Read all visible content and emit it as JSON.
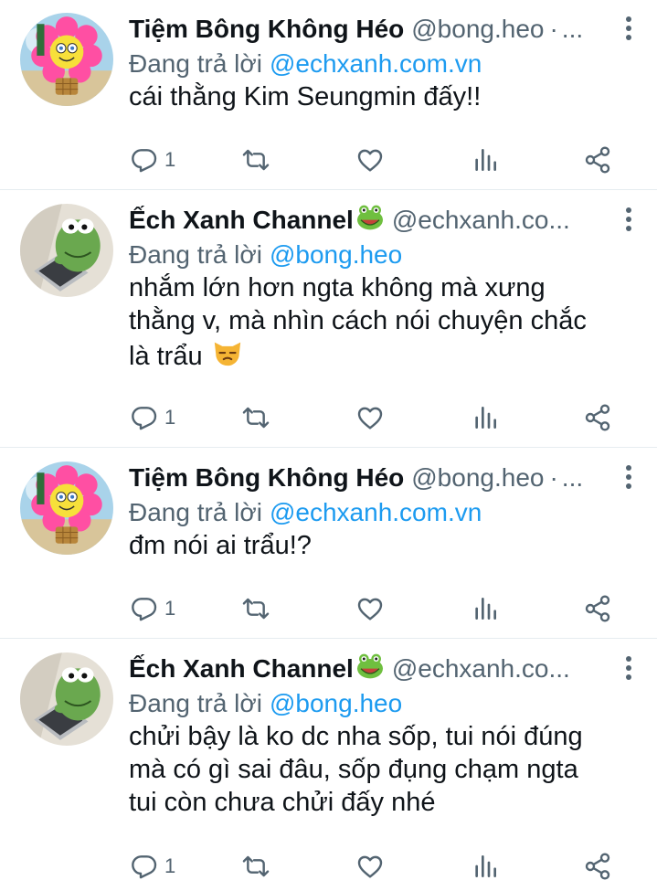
{
  "colors": {
    "link": "#1d9bf0",
    "muted": "#536471",
    "text": "#0f1419"
  },
  "reply_prefix": "Đang trả lời",
  "tweets": [
    {
      "name": "Tiệm Bông Không Héo",
      "handle": "@bong.heo",
      "separator": "·",
      "ellipsis": "...",
      "replying_to": "@echxanh.com.vn",
      "text": "cái thằng Kim Seungmin đấy!!",
      "reply_count": "1",
      "avatar": "sponge-flower-avatar"
    },
    {
      "name": "Ếch Xanh Channel",
      "handle": "@echxanh.co...",
      "name_emoji": "frog-emoji",
      "replying_to": "@bong.heo",
      "text": "nhắm lớn hơn ngta không mà xưng thằng v, mà nhìn cách nói chuyện chắc là trẩu",
      "text_emoji": "unamused-cat-emoji",
      "reply_count": "1",
      "avatar": "kermit-laptop-avatar"
    },
    {
      "name": "Tiệm Bông Không Héo",
      "handle": "@bong.heo",
      "separator": "·",
      "ellipsis": "...",
      "replying_to": "@echxanh.com.vn",
      "text": "đm nói ai trẩu!?",
      "reply_count": "1",
      "avatar": "sponge-flower-avatar"
    },
    {
      "name": "Ếch Xanh Channel",
      "handle": "@echxanh.co...",
      "name_emoji": "frog-emoji",
      "replying_to": "@bong.heo",
      "text": "chửi bậy là ko dc nha sốp, tui nói đúng mà có gì sai đâu, sốp đụng chạm ngta tui còn chưa chửi đấy nhé",
      "reply_count": "1",
      "avatar": "kermit-laptop-avatar"
    }
  ]
}
